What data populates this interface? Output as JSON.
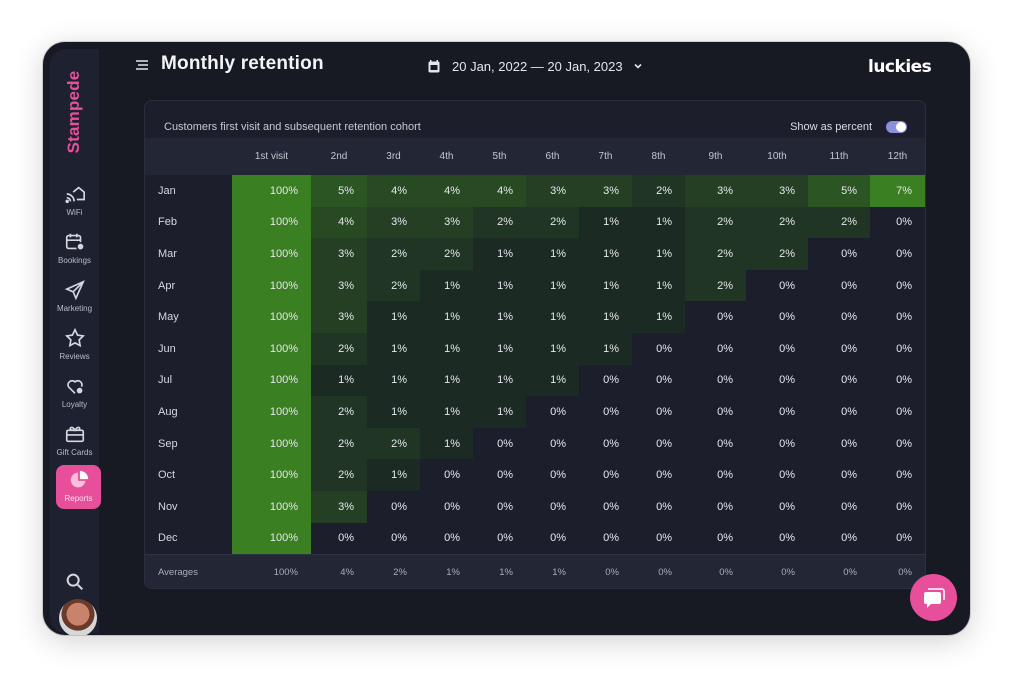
{
  "app": {
    "brand": "Stampede",
    "org_logo": "luckies"
  },
  "header": {
    "menu_icon": "hamburger-menu-icon",
    "title": "Monthly retention",
    "date_range": "20 Jan, 2022 — 20 Jan, 2023"
  },
  "sidebar": {
    "items": [
      {
        "label": "WiFi",
        "icon": "wifi-house-icon"
      },
      {
        "label": "Bookings",
        "icon": "calendar-user-icon"
      },
      {
        "label": "Marketing",
        "icon": "paper-plane-icon"
      },
      {
        "label": "Reviews",
        "icon": "star-icon"
      },
      {
        "label": "Loyalty",
        "icon": "heart-badge-icon"
      },
      {
        "label": "Gift Cards",
        "icon": "gift-icon"
      },
      {
        "label": "Reports",
        "icon": "pie-chart-icon",
        "active": true
      }
    ],
    "search_icon": "search-icon",
    "avatar": "user-avatar"
  },
  "card": {
    "title": "Customers first visit and subsequent retention cohort",
    "toggle_label": "Show as percent",
    "toggle_on": true
  },
  "colors": {
    "accent": "#e84f9b",
    "heat_max": "#3a7f22",
    "heat_min": "#1c2a24",
    "empty": "#1c1f2b"
  },
  "chart_data": {
    "type": "heatmap",
    "title": "Customers first visit and subsequent retention cohort",
    "columns": [
      "1st visit",
      "2nd",
      "3rd",
      "4th",
      "5th",
      "6th",
      "7th",
      "8th",
      "9th",
      "10th",
      "11th",
      "12th"
    ],
    "rows": [
      "Jan",
      "Feb",
      "Mar",
      "Apr",
      "May",
      "Jun",
      "Jul",
      "Aug",
      "Sep",
      "Oct",
      "Nov",
      "Dec"
    ],
    "unit": "%",
    "values": [
      [
        100,
        5,
        4,
        4,
        4,
        3,
        3,
        2,
        3,
        3,
        5,
        7
      ],
      [
        100,
        4,
        3,
        3,
        2,
        2,
        1,
        1,
        2,
        2,
        2,
        0
      ],
      [
        100,
        3,
        2,
        2,
        1,
        1,
        1,
        1,
        2,
        2,
        0,
        0
      ],
      [
        100,
        3,
        2,
        1,
        1,
        1,
        1,
        1,
        2,
        0,
        0,
        0
      ],
      [
        100,
        3,
        1,
        1,
        1,
        1,
        1,
        1,
        0,
        0,
        0,
        0
      ],
      [
        100,
        2,
        1,
        1,
        1,
        1,
        1,
        0,
        0,
        0,
        0,
        0
      ],
      [
        100,
        1,
        1,
        1,
        1,
        1,
        0,
        0,
        0,
        0,
        0,
        0
      ],
      [
        100,
        2,
        1,
        1,
        1,
        0,
        0,
        0,
        0,
        0,
        0,
        0
      ],
      [
        100,
        2,
        2,
        1,
        0,
        0,
        0,
        0,
        0,
        0,
        0,
        0
      ],
      [
        100,
        2,
        1,
        0,
        0,
        0,
        0,
        0,
        0,
        0,
        0,
        0
      ],
      [
        100,
        3,
        0,
        0,
        0,
        0,
        0,
        0,
        0,
        0,
        0,
        0
      ],
      [
        100,
        0,
        0,
        0,
        0,
        0,
        0,
        0,
        0,
        0,
        0,
        0
      ]
    ],
    "averages_label": "Averages",
    "averages": [
      100,
      4,
      2,
      1,
      1,
      1,
      0,
      0,
      0,
      0,
      0,
      0
    ]
  },
  "chat_button": {
    "icon": "chat-bubble-icon"
  }
}
